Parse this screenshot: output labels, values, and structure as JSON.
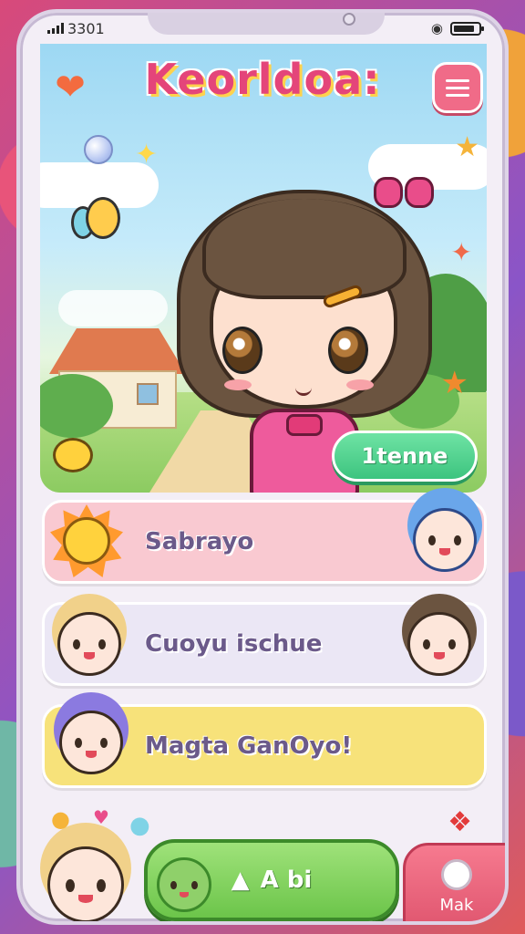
{
  "status_bar": {
    "time": "3301"
  },
  "header": {
    "title": "Keorldoa:"
  },
  "hero": {
    "home_button_label": "1tenne"
  },
  "cards": [
    {
      "label": "Sabrayo",
      "color": "#f9c9d1"
    },
    {
      "label": "Cuoyu ischue",
      "color": "#ebe7f5"
    },
    {
      "label": "Magta GanOyo!",
      "color": "#f7e27a"
    }
  ],
  "bottom_nav": {
    "play_label": "A bi",
    "make_label": "Mak"
  },
  "colors": {
    "accent_pink": "#e4457a",
    "accent_green": "#3cc47f",
    "menu_pink": "#f06b88"
  },
  "icons": [
    "heart-icon",
    "menu-icon",
    "wifi-icon",
    "battery-icon",
    "signal-icon"
  ]
}
